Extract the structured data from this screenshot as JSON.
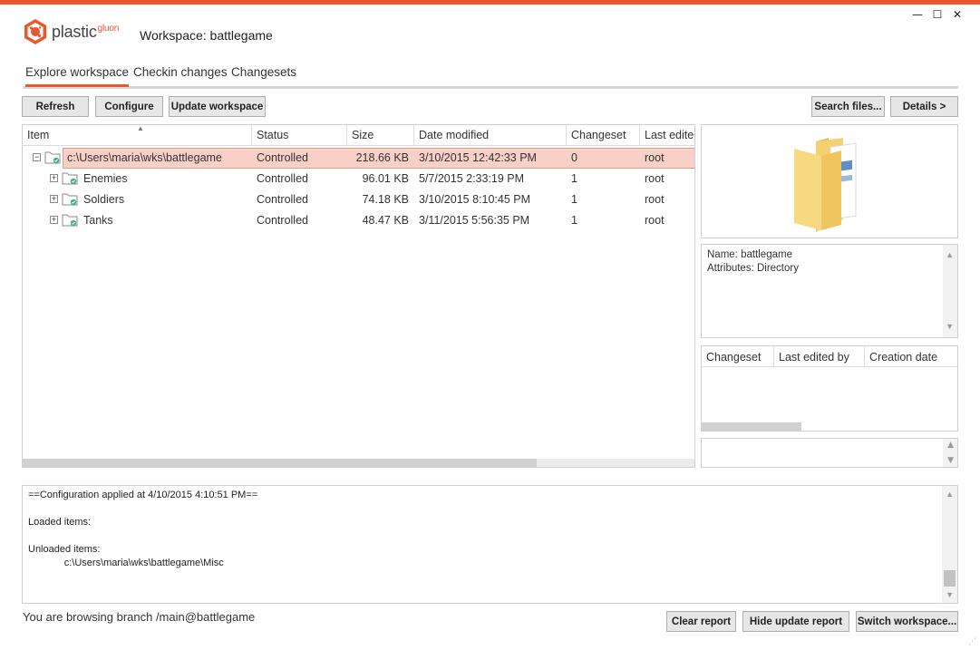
{
  "app": {
    "logo_text": "plastic",
    "logo_sup": "gluon",
    "workspace_title": "Workspace: battlegame",
    "accent": "#e9572b"
  },
  "window": {
    "minimize": "—",
    "maximize": "☐",
    "close": "✕"
  },
  "tabs": [
    {
      "label": "Explore workspace",
      "active": true
    },
    {
      "label": "Checkin changes",
      "active": false
    },
    {
      "label": "Changesets",
      "active": false
    }
  ],
  "toolbar": {
    "refresh": "Refresh",
    "configure": "Configure",
    "update_workspace": "Update workspace",
    "search_files": "Search files...",
    "details": "Details >"
  },
  "grid": {
    "columns": [
      "Item",
      "Status",
      "Size",
      "Date modified",
      "Changeset",
      "Last edited"
    ],
    "rows": [
      {
        "expander": "−",
        "name": "c:\\Users\\maria\\wks\\battlegame",
        "status": "Controlled",
        "size": "218.66 KB",
        "date": "3/10/2015 12:42:33 PM",
        "changeset": "0",
        "last_edited": "root",
        "selected": true
      },
      {
        "expander": "+",
        "name": "Enemies",
        "status": "Controlled",
        "size": "96.01 KB",
        "date": "5/7/2015 2:33:19 PM",
        "changeset": "1",
        "last_edited": "root",
        "selected": false
      },
      {
        "expander": "+",
        "name": "Soldiers",
        "status": "Controlled",
        "size": "74.18 KB",
        "date": "3/10/2015 8:10:45 PM",
        "changeset": "1",
        "last_edited": "root",
        "selected": false
      },
      {
        "expander": "+",
        "name": "Tanks",
        "status": "Controlled",
        "size": "48.47 KB",
        "date": "3/11/2015 5:56:35 PM",
        "changeset": "1",
        "last_edited": "root",
        "selected": false
      }
    ]
  },
  "properties": {
    "name": "Name: battlegame",
    "attributes": "Attributes: Directory"
  },
  "history": {
    "columns": [
      "Changeset",
      "Last edited by",
      "Creation date"
    ]
  },
  "report": {
    "lines": [
      "==Configuration applied at 4/10/2015 4:10:51 PM==",
      "",
      "Loaded items:",
      "",
      "Unloaded items:",
      "             c:\\Users\\maria\\wks\\battlegame\\Misc"
    ]
  },
  "footer": {
    "status": "You are browsing branch /main@battlegame",
    "clear_report": "Clear report",
    "hide_update_report": "Hide update report",
    "switch_workspace": "Switch workspace..."
  }
}
